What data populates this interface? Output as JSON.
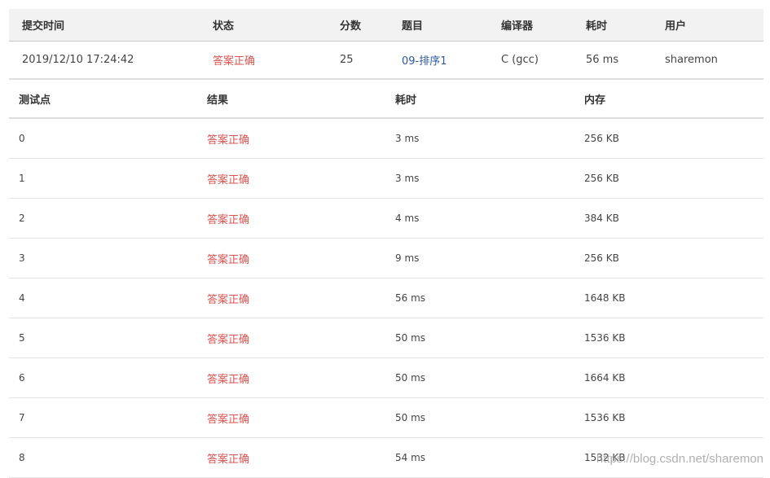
{
  "submission": {
    "headers": [
      "提交时间",
      "状态",
      "分数",
      "题目",
      "编译器",
      "耗时",
      "用户"
    ],
    "time": "2019/12/10 17:24:42",
    "status": "答案正确",
    "score": "25",
    "problem": "09-排序1",
    "compiler": "C (gcc)",
    "elapsed": "56 ms",
    "user": "sharemon"
  },
  "cases": {
    "headers": [
      "测试点",
      "结果",
      "耗时",
      "内存"
    ],
    "rows": [
      {
        "id": "0",
        "result": "答案正确",
        "time": "3 ms",
        "memory": "256 KB"
      },
      {
        "id": "1",
        "result": "答案正确",
        "time": "3 ms",
        "memory": "256 KB"
      },
      {
        "id": "2",
        "result": "答案正确",
        "time": "4 ms",
        "memory": "384 KB"
      },
      {
        "id": "3",
        "result": "答案正确",
        "time": "9 ms",
        "memory": "256 KB"
      },
      {
        "id": "4",
        "result": "答案正确",
        "time": "56 ms",
        "memory": "1648 KB"
      },
      {
        "id": "5",
        "result": "答案正确",
        "time": "50 ms",
        "memory": "1536 KB"
      },
      {
        "id": "6",
        "result": "答案正确",
        "time": "50 ms",
        "memory": "1664 KB"
      },
      {
        "id": "7",
        "result": "答案正确",
        "time": "50 ms",
        "memory": "1536 KB"
      },
      {
        "id": "8",
        "result": "答案正确",
        "time": "54 ms",
        "memory": "1532 KB"
      }
    ]
  },
  "watermark": "https://blog.csdn.net/sharemon",
  "colors": {
    "accepted": "#d9534f",
    "link": "#2c5aa0",
    "header_bg": "#f2f2f2"
  }
}
